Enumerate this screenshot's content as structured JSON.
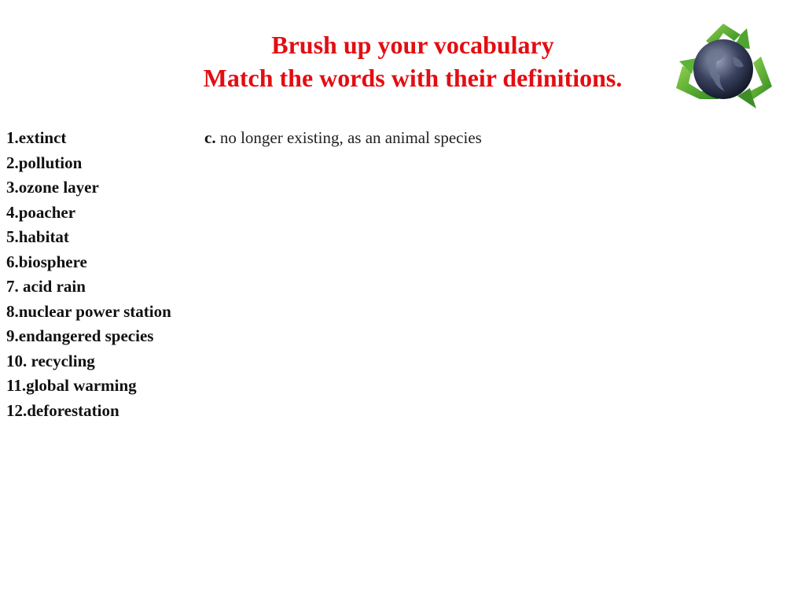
{
  "header": {
    "title": "Brush up your vocabulary",
    "subtitle": "Match the words with their definitions.",
    "title_color": "#e30d12"
  },
  "logo": {
    "icon": "recycling-globe-icon"
  },
  "words": [
    "1.extinct",
    "2.pollution",
    "3.ozone layer",
    "4.poacher",
    "5.habitat",
    "6.biosphere",
    "7. acid rain",
    "8.nuclear power station",
    "9.endangered species",
    "10. recycling",
    "11.global warming",
    "12.deforestation"
  ],
  "definition": {
    "letter": "c.",
    "text": " no longer existing, as an animal species"
  }
}
